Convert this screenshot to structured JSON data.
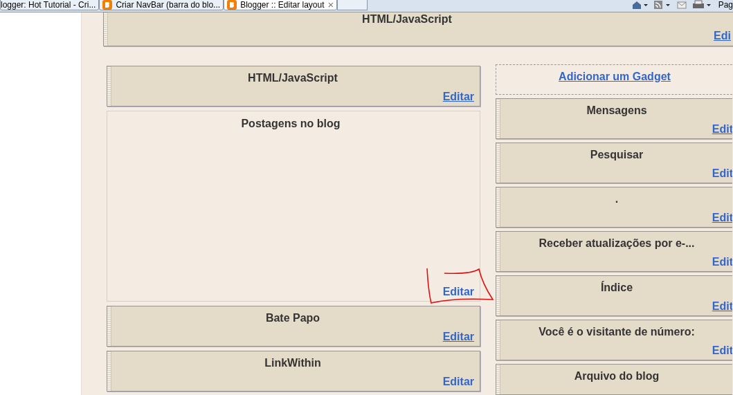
{
  "browser_tabs": [
    {
      "title": "logger: Hot Tutorial - Cri...",
      "selected": false,
      "has_icon": false
    },
    {
      "title": "Criar NavBar (barra do blo...",
      "selected": false,
      "has_icon": true
    },
    {
      "title": "Blogger :: Editar layout",
      "selected": true,
      "has_icon": true,
      "close": "×"
    }
  ],
  "toolbar": {
    "page_menu": "Pag"
  },
  "header_gadget": {
    "title": "HTML/JavaScript",
    "edit": "Edi",
    "underlined": true
  },
  "left_column": [
    {
      "kind": "gadget",
      "title": "HTML/JavaScript",
      "edit": "Editar",
      "underlined": true
    },
    {
      "kind": "main",
      "title": "Postagens no blog",
      "edit": "Editar",
      "underlined": false
    },
    {
      "kind": "gadget",
      "title": "Bate Papo",
      "edit": "Editar",
      "underlined": true
    },
    {
      "kind": "gadget",
      "title": "LinkWithin",
      "edit": "Editar",
      "underlined": false
    }
  ],
  "right_column": [
    {
      "kind": "add",
      "title": "Adicionar um Gadget"
    },
    {
      "kind": "gadget",
      "title": "Mensagens",
      "edit": "Edit",
      "underlined": true
    },
    {
      "kind": "gadget",
      "title": "Pesquisar",
      "edit": "Edit",
      "underlined": false
    },
    {
      "kind": "gadget",
      "title": ".",
      "edit": "Edit",
      "underlined": true
    },
    {
      "kind": "gadget",
      "title": "Receber atualizações por e-...",
      "edit": "Edit",
      "underlined": false
    },
    {
      "kind": "gadget",
      "title": "Índice",
      "edit": "Edit",
      "underlined": true
    },
    {
      "kind": "gadget",
      "title": "Você é o visitante de número:",
      "edit": "Edit",
      "underlined": false
    },
    {
      "kind": "gadget",
      "title": "Arquivo do blog"
    }
  ]
}
